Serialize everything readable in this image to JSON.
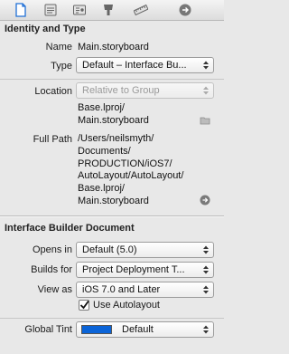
{
  "toolbar": {
    "icons": [
      "file-inspector-icon",
      "quick-help-icon",
      "identity-inspector-icon",
      "attributes-inspector-icon",
      "size-inspector-icon",
      "connections-inspector-icon"
    ]
  },
  "identity_section": {
    "title": "Identity and Type",
    "name_label": "Name",
    "name_value": "Main.storyboard",
    "type_label": "Type",
    "type_value": "Default – Interface Bu...",
    "location_label": "Location",
    "location_value": "Relative to Group",
    "location_file_lines": [
      "Base.lproj/",
      "Main.storyboard"
    ],
    "fullpath_label": "Full Path",
    "fullpath_lines": [
      "/Users/neilsmyth/",
      "Documents/",
      "PRODUCTION/iOS7/",
      "AutoLayout/AutoLayout/",
      "Base.lproj/",
      "Main.storyboard"
    ]
  },
  "ib_section": {
    "title": "Interface Builder Document",
    "opens_in_label": "Opens in",
    "opens_in_value": "Default (5.0)",
    "builds_for_label": "Builds for",
    "builds_for_value": "Project Deployment T...",
    "view_as_label": "View as",
    "view_as_value": "iOS 7.0 and Later",
    "use_autolayout_label": "Use Autolayout",
    "use_autolayout_checked": true,
    "global_tint_label": "Global Tint",
    "global_tint_value": "Default",
    "global_tint_color": "#0b64d8"
  }
}
